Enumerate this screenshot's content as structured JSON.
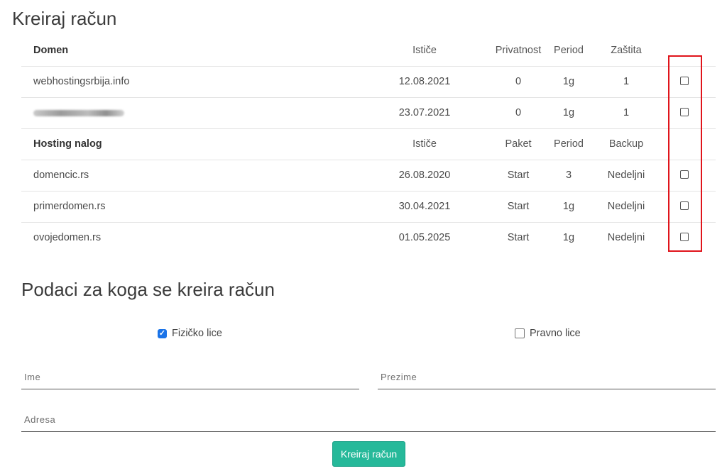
{
  "page_title": "Kreiraj račun",
  "domains": {
    "headers": {
      "name": "Domen",
      "expires": "Ističe",
      "a": "Privatnost",
      "b": "Period",
      "c": "Zaštita"
    },
    "rows": [
      {
        "name": "webhostingsrbija.info",
        "expires": "12.08.2021",
        "a": "0",
        "b": "1g",
        "c": "1",
        "checked": false
      },
      {
        "name": "",
        "expires": "23.07.2021",
        "a": "0",
        "b": "1g",
        "c": "1",
        "checked": false
      }
    ]
  },
  "hosting": {
    "headers": {
      "name": "Hosting nalog",
      "expires": "Ističe",
      "a": "Paket",
      "b": "Period",
      "c": "Backup"
    },
    "rows": [
      {
        "name": "domencic.rs",
        "expires": "26.08.2020",
        "a": "Start",
        "b": "3",
        "c": "Nedeljni",
        "checked": false
      },
      {
        "name": "primerdomen.rs",
        "expires": "30.04.2021",
        "a": "Start",
        "b": "1g",
        "c": "Nedeljni",
        "checked": false
      },
      {
        "name": "ovojedomen.rs",
        "expires": "01.05.2025",
        "a": "Start",
        "b": "1g",
        "c": "Nedeljni",
        "checked": false
      }
    ]
  },
  "form": {
    "title": "Podaci za koga se kreira račun",
    "person_type": {
      "options": [
        {
          "label": "Fizičko lice",
          "checked": true
        },
        {
          "label": "Pravno lice",
          "checked": false
        }
      ]
    },
    "first_name_label": "Ime",
    "last_name_label": "Prezime",
    "address_label": "Adresa",
    "submit_label": "Kreiraj račun"
  },
  "colors": {
    "accent_button": "#26b99a",
    "highlight_box": "#e0141b",
    "checkbox_checked": "#1a73e8"
  }
}
